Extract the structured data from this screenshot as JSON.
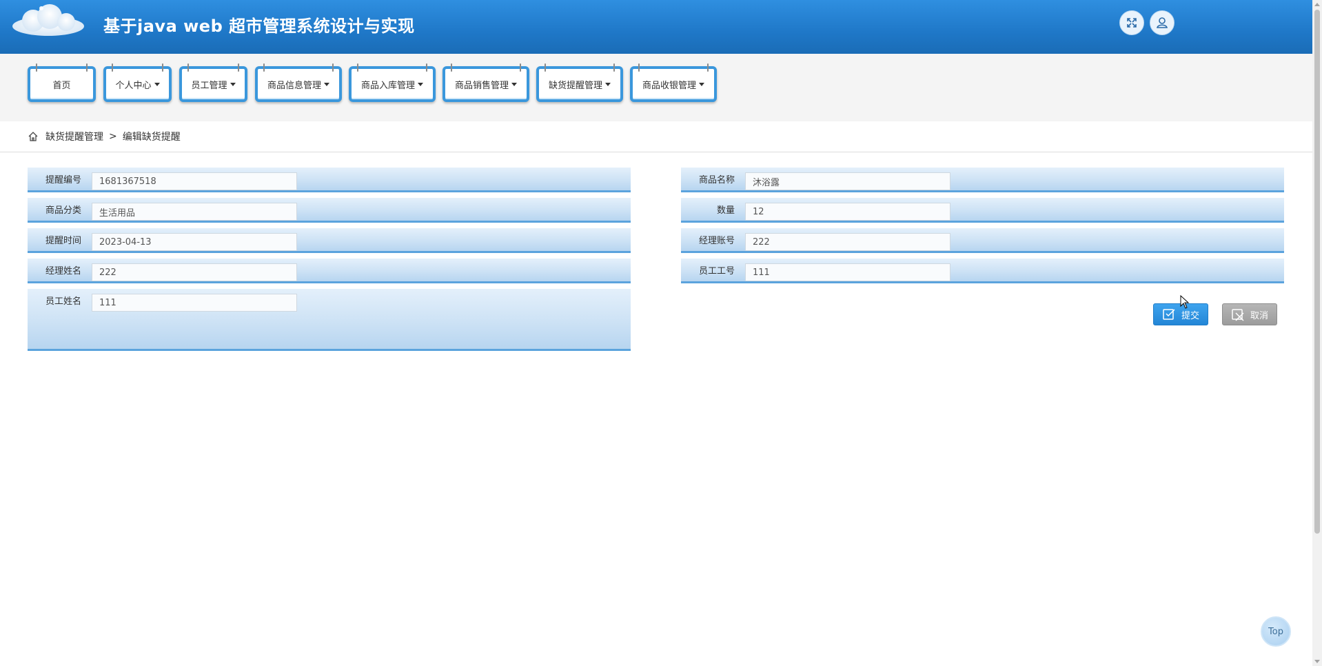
{
  "app": {
    "title": "基于java web 超市管理系统设计与实现"
  },
  "header": {
    "icons": [
      "fullscreen-icon",
      "user-icon"
    ]
  },
  "nav": {
    "items": [
      {
        "label": "首页",
        "has_dropdown": false
      },
      {
        "label": "个人中心",
        "has_dropdown": true
      },
      {
        "label": "员工管理",
        "has_dropdown": true
      },
      {
        "label": "商品信息管理",
        "has_dropdown": true
      },
      {
        "label": "商品入库管理",
        "has_dropdown": true
      },
      {
        "label": "商品销售管理",
        "has_dropdown": true
      },
      {
        "label": "缺货提醒管理",
        "has_dropdown": true
      },
      {
        "label": "商品收银管理",
        "has_dropdown": true
      }
    ]
  },
  "breadcrumb": {
    "icon": "home-icon",
    "parent": "缺货提醒管理",
    "separator": ">",
    "current": "编辑缺货提醒"
  },
  "form": {
    "reminder_no": {
      "label": "提醒编号",
      "value": "1681367518"
    },
    "product_name": {
      "label": "商品名称",
      "value": "沐浴露"
    },
    "category": {
      "label": "商品分类",
      "value": "生活用品"
    },
    "quantity": {
      "label": "数量",
      "value": "12"
    },
    "remind_time": {
      "label": "提醒时间",
      "value": "2023-04-13"
    },
    "manager_account": {
      "label": "经理账号",
      "value": "222"
    },
    "manager_name": {
      "label": "经理姓名",
      "value": "222"
    },
    "employee_no": {
      "label": "员工工号",
      "value": "111"
    },
    "employee_name": {
      "label": "员工姓名",
      "value": "111"
    }
  },
  "actions": {
    "submit_label": "提交",
    "cancel_label": "取消"
  },
  "back_to_top": {
    "label": "Top"
  },
  "colors": {
    "header_blue": "#1f78c8",
    "nav_border": "#3a97dc",
    "form_row": "#cde2f5",
    "submit": "#2386d6",
    "cancel": "#9c9c9c"
  }
}
